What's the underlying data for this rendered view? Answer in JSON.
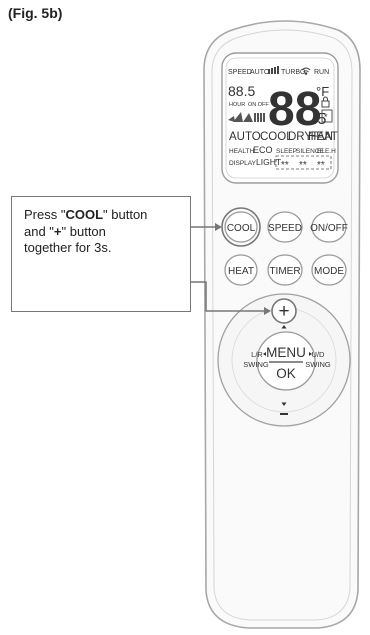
{
  "figure_label": "(Fig. 5b)",
  "lcd": {
    "top_row": [
      "SPEED",
      "AUTO",
      "TURBO",
      "RUN"
    ],
    "small_digits": "88.5",
    "hour": "HOUR",
    "on_off": "ON OFF",
    "big_digits": "88",
    "big_decimal": ".5",
    "degree": "°F",
    "modes": [
      "AUTO",
      "COOL",
      "DRY",
      "HEAT",
      "FAN"
    ],
    "row_health": [
      "HEALTH",
      "ECO",
      "SLEEP",
      "SILENCE",
      "ELE.H"
    ],
    "row_display": [
      "DISPLAY",
      "LIGHT"
    ],
    "stars": [
      "**",
      "**",
      "**"
    ]
  },
  "buttons": {
    "cool": "COOL",
    "speed": "SPEED",
    "onoff": "ON/OFF",
    "heat": "HEAT",
    "timer": "TIMER",
    "mode": "MODE",
    "plus": "+",
    "minus": "-",
    "menu": "MENU",
    "ok": "OK",
    "lr_swing": [
      "L/R",
      "SWING"
    ],
    "ud_swing": [
      "U/D",
      "SWING"
    ]
  },
  "callout": {
    "line1_pre": "Press \"",
    "line1_bold": "COOL",
    "line1_post": "\" button",
    "line2_pre": "and \"",
    "line2_bold": "+",
    "line2_post": "\" button",
    "line3": "together for 3s."
  },
  "colors": {
    "outline": "#9a9a9a",
    "arrow": "#777777"
  }
}
